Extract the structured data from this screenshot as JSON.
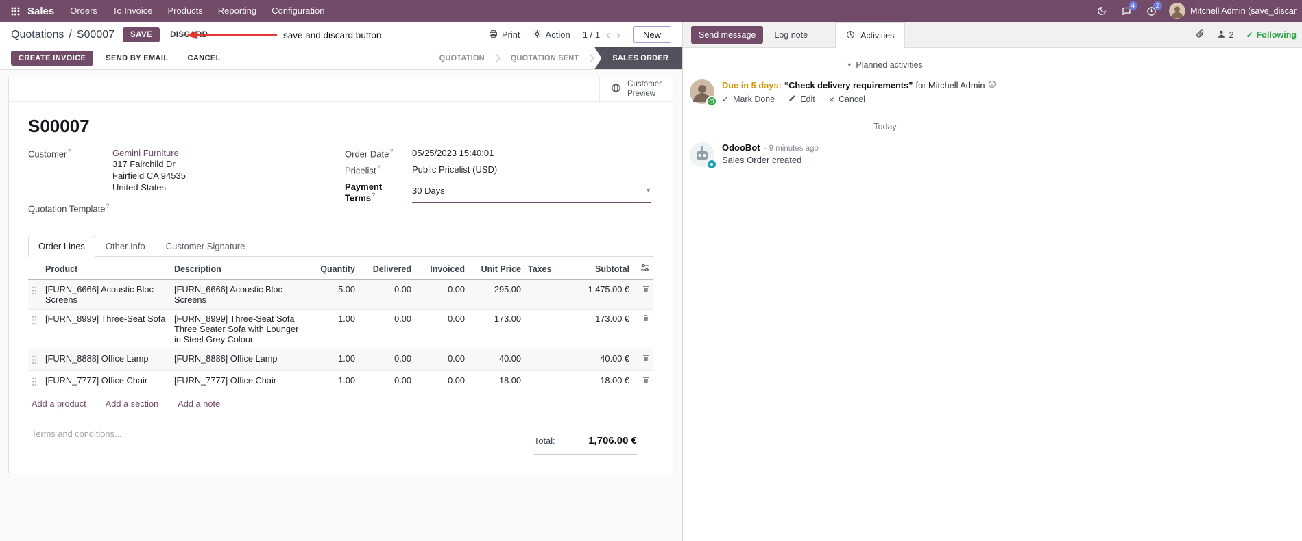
{
  "navbar": {
    "app_name": "Sales",
    "menus": [
      "Orders",
      "To Invoice",
      "Products",
      "Reporting",
      "Configuration"
    ],
    "message_badge": "4",
    "activity_badge": "2",
    "user_name": "Mitchell Admin (save_discar"
  },
  "control_panel": {
    "breadcrumb_parent": "Quotations",
    "breadcrumb_sep": "/",
    "breadcrumb_current": "S00007",
    "save": "SAVE",
    "discard": "DISCARD",
    "print": "Print",
    "action": "Action",
    "pager": "1 / 1",
    "new": "New"
  },
  "annotation": {
    "text": "save and discard button"
  },
  "statusbar": {
    "create_invoice": "CREATE INVOICE",
    "send_by_email": "SEND BY EMAIL",
    "cancel": "CANCEL",
    "steps": [
      "QUOTATION",
      "QUOTATION SENT",
      "SALES ORDER"
    ],
    "active_step": "SALES ORDER"
  },
  "form": {
    "help_marker": "?",
    "customer_preview_line1": "Customer",
    "customer_preview_line2": "Preview",
    "title": "S00007",
    "customer_label": "Customer",
    "customer_name": "Gemini Furniture",
    "address1": "317 Fairchild Dr",
    "address2": "Fairfield CA 94535",
    "address3": "United States",
    "order_date_label": "Order Date",
    "order_date": "05/25/2023 15:40:01",
    "pricelist_label": "Pricelist",
    "pricelist": "Public Pricelist (USD)",
    "payment_terms_label": "Payment Terms",
    "payment_terms": "30 Days",
    "quotation_template_label": "Quotation Template",
    "tabs": {
      "order_lines": "Order Lines",
      "other_info": "Other Info",
      "customer_signature": "Customer Signature"
    },
    "table": {
      "headers": {
        "product": "Product",
        "description": "Description",
        "quantity": "Quantity",
        "delivered": "Delivered",
        "invoiced": "Invoiced",
        "unit_price": "Unit Price",
        "taxes": "Taxes",
        "subtotal": "Subtotal"
      },
      "rows": [
        {
          "product": "[FURN_6666] Acoustic Bloc Screens",
          "description": "[FURN_6666] Acoustic Bloc Screens",
          "description2": "",
          "quantity": "5.00",
          "delivered": "0.00",
          "invoiced": "0.00",
          "unit_price": "295.00",
          "taxes": "",
          "subtotal": "1,475.00 €"
        },
        {
          "product": "[FURN_8999] Three-Seat Sofa",
          "description": "[FURN_8999] Three-Seat Sofa",
          "description2": "Three Seater Sofa with Lounger in Steel Grey Colour",
          "quantity": "1.00",
          "delivered": "0.00",
          "invoiced": "0.00",
          "unit_price": "173.00",
          "taxes": "",
          "subtotal": "173.00 €"
        },
        {
          "product": "[FURN_8888] Office Lamp",
          "description": "[FURN_8888] Office Lamp",
          "description2": "",
          "quantity": "1.00",
          "delivered": "0.00",
          "invoiced": "0.00",
          "unit_price": "40.00",
          "taxes": "",
          "subtotal": "40.00 €"
        },
        {
          "product": "[FURN_7777] Office Chair",
          "description": "[FURN_7777] Office Chair",
          "description2": "",
          "quantity": "1.00",
          "delivered": "0.00",
          "invoiced": "0.00",
          "unit_price": "18.00",
          "taxes": "",
          "subtotal": "18.00 €"
        }
      ],
      "add_product": "Add a product",
      "add_section": "Add a section",
      "add_note": "Add a note"
    },
    "terms_placeholder": "Terms and conditions...",
    "total_label": "Total:",
    "total_value": "1,706.00 €"
  },
  "chatter": {
    "send_message": "Send message",
    "log_note": "Log note",
    "activities": "Activities",
    "follower_count": "2",
    "following": "Following",
    "planned_activities": "Planned activities",
    "activity": {
      "due": "Due in 5 days:",
      "summary": "“Check delivery requirements”",
      "assignee": "for Mitchell Admin",
      "mark_done": "Mark Done",
      "edit": "Edit",
      "cancel": "Cancel"
    },
    "today": "Today",
    "message": {
      "author": "OdooBot",
      "time": "- 9 minutes ago",
      "body": "Sales Order created"
    }
  }
}
